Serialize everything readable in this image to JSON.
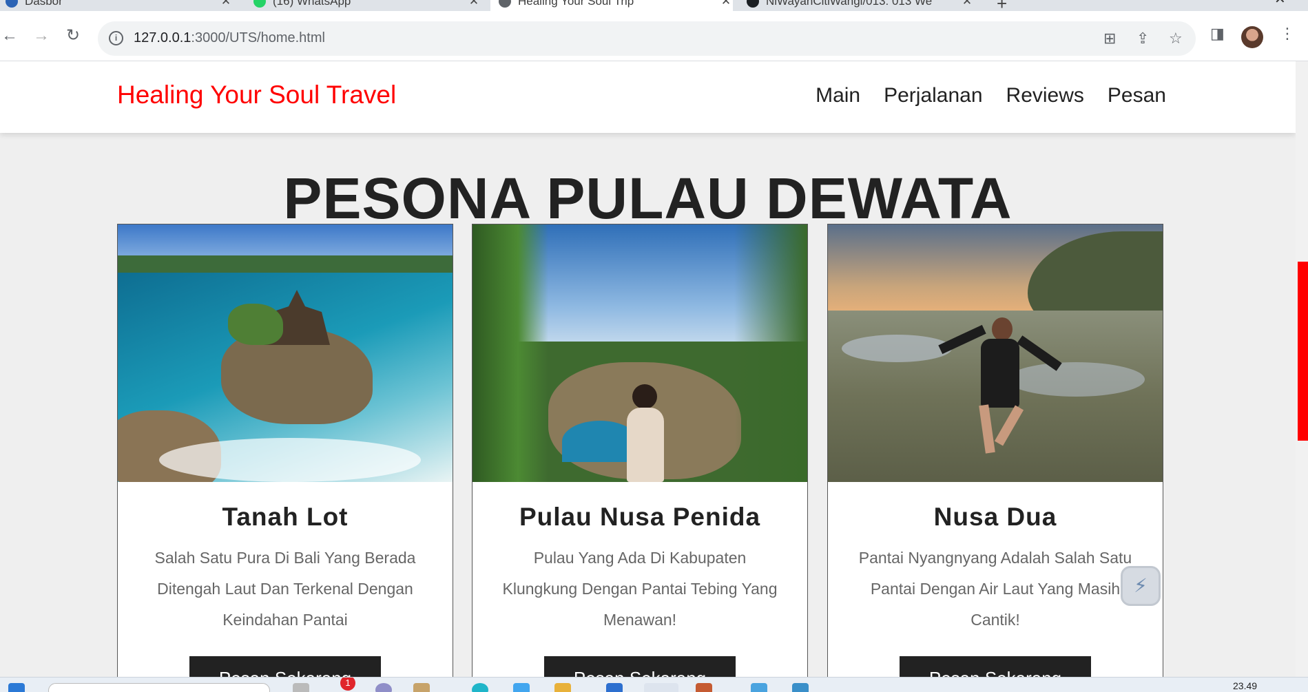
{
  "browser": {
    "tabs": [
      {
        "title": "Dasbor",
        "favicon_color": "#2c64b5",
        "active": false
      },
      {
        "title": "(16) WhatsApp",
        "favicon_color": "#25d366",
        "active": false
      },
      {
        "title": "Healing Your Soul Trip",
        "favicon_color": "#5f6368",
        "active": true
      },
      {
        "title": "NiWayanCitiWangi/013: 013 We",
        "favicon_color": "#1b1f23",
        "active": false
      }
    ],
    "new_tab": "+",
    "close_glyph": "✕",
    "url_host": "127.0.0.1",
    "url_rest": ":3000/UTS/home.html",
    "info_glyph": "i"
  },
  "site": {
    "logo": "Healing Your Soul Travel",
    "nav": [
      "Main",
      "Perjalanan",
      "Reviews",
      "Pesan"
    ],
    "headline": "PESONA PULAU DEWATA",
    "accent_color": "#ff0000",
    "cards": [
      {
        "title": "Tanah Lot",
        "description": "Salah Satu Pura Di Bali Yang Berada Ditengah Laut Dan Terkenal Dengan Keindahan Pantai",
        "button": "Pesan Sekarang"
      },
      {
        "title": "Pulau Nusa Penida",
        "description": "Pulau Yang Ada Di Kabupaten Klungkung Dengan Pantai Tebing Yang Menawan!",
        "button": "Pesan Sekarang"
      },
      {
        "title": "Nusa Dua",
        "description": "Pantai Nyangnyang Adalah Salah Satu Pantai Dengan Air Laut Yang Masih Cantik!",
        "button": "Pesan Sekarang"
      }
    ]
  },
  "taskbar": {
    "notification_count": "1",
    "clock": "23.49"
  }
}
